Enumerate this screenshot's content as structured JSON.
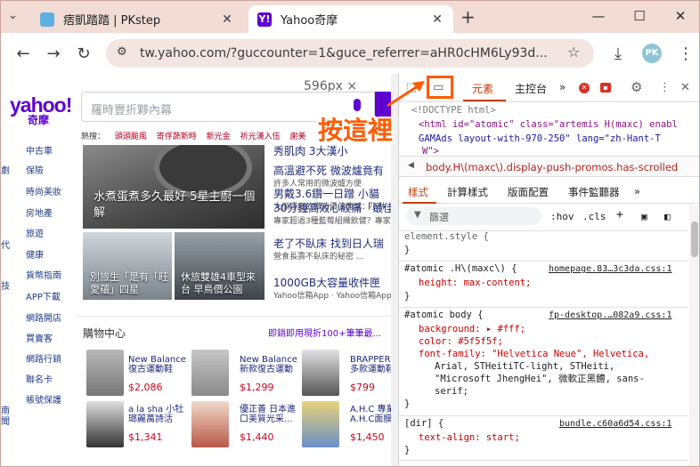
{
  "tabs": [
    {
      "title": "痞凱踏踏 | PKstep",
      "favicon_color": "#5bb0e0"
    },
    {
      "title": "Yahoo奇摩",
      "favicon_color": "#5f01d1"
    }
  ],
  "window": {
    "new_tab": "+",
    "minimize": "—",
    "maximize": "☐",
    "close": "✕"
  },
  "toolbar": {
    "back": "←",
    "forward": "→",
    "reload": "↻",
    "url": "tw.yahoo.com/?guccounter=1&guce_referrer=aHR0cHM6Ly93d...",
    "star": "☆",
    "download": "⤓",
    "avatar": "PK",
    "menu": "⋮"
  },
  "viewport": {
    "dims": "596px × 588px",
    "logo": "yahoo!",
    "logo_sub": "奇摩",
    "search_placeholder": "羅時豐折夥內幕",
    "hot_label": "熱搜：",
    "hot_items": [
      "頭頭颱風",
      "寄俘蔬新時",
      "新光金",
      "祈光漢入伍",
      "謝美"
    ]
  },
  "categories": [
    {
      "edge": "",
      "label": "中古車"
    },
    {
      "edge": "劇",
      "label": "保險"
    },
    {
      "edge": "",
      "label": "時尚美妝"
    },
    {
      "edge": "",
      "label": "房地產"
    },
    {
      "edge": "",
      "label": "旅遊"
    },
    {
      "edge": "代",
      "label": "健康"
    },
    {
      "edge": "",
      "label": "貨幣指南"
    },
    {
      "edge": "技",
      "label": "APP下載"
    },
    {
      "edge": "",
      "label": "網路開店"
    },
    {
      "edge": "",
      "label": "買賣客"
    },
    {
      "edge": "",
      "label": "網路行銷"
    },
    {
      "edge": "",
      "label": "聯名卡"
    },
    {
      "edge": "南",
      "label": "帳號保護"
    },
    {
      "edge": "聞",
      "label": ""
    }
  ],
  "news": {
    "main_caption": "水煮蛋煮多久最好 5星主廚一個解",
    "thumb1_caption": "別旅生「是有「旺愛蘊」四星",
    "thumb2_caption": "休旅雙雄4車型來台 早鳥價公園",
    "headlines": [
      {
        "title": "秀肌肉 3大漢小",
        "sub": "",
        "red": false
      },
      {
        "title": "高溫避不死 微波爐竟有",
        "sub": "許多人常用的微波爐方便",
        "red": false
      },
      {
        "title": "男戴3.6鑽一日蹭 小貓",
        "sub": "大傑理度的鑽石價值連城：小林",
        "red": false
      },
      {
        "title": "30分鐘高效心絞痛「最佳",
        "sub": "專家超過3種藍莓組織飲健？專家",
        "red": false
      },
      {
        "title": "老了不臥床 找到日人瑞",
        "sub": "營食長壽不臥床的秘密 ...",
        "red": false
      },
      {
        "title": "1000GB大容量收件匣",
        "sub": "Yahoo信箱App · Yahoo信箱App",
        "red": false
      }
    ]
  },
  "shop": {
    "title": "購物中心",
    "promo": "即銷即用現折100+筆筆最...",
    "products": [
      {
        "name1": "New Balance",
        "name2": "復古運動鞋",
        "price": "$2,086"
      },
      {
        "name1": "New Balance",
        "name2": "新款復古運動",
        "price": "$1,299"
      },
      {
        "name1": "BRAPPER",
        "name2": "多款運動鞋",
        "price": "$799"
      },
      {
        "name1": "a la sha 小牡",
        "name2": "瑯麗萬詩活",
        "price": "$1,341"
      },
      {
        "name1": "優正善 日本進",
        "name2": "口美質光采...",
        "price": "$1,440"
      },
      {
        "name1": "A.H.C 專業",
        "name2": "A.H.C面膜...",
        "price": "$1,450"
      }
    ]
  },
  "annotation": {
    "text": "按這裡"
  },
  "devtools": {
    "tabs": [
      "元素",
      "主控台"
    ],
    "more": "»",
    "error_badge": "✕",
    "msg_badge": "▪",
    "code_lines": {
      "doctype": "<!DOCTYPE html>",
      "html_open": "<html id=\"atomic\" class=\"artemis H(maxc) enabl",
      "html_line2": "GAMAds layout-with-970-250\" lang=\"zh-Hant-T",
      "html_line3": "W\">"
    },
    "breadcrumb": "body.H\\(maxc\\).display-push-promos.has-scrolled",
    "sub_tabs": [
      "樣式",
      "計算樣式",
      "版面配置",
      "事件監聽器",
      "»"
    ],
    "filter_placeholder": "篩選",
    "hov": ":hov",
    "cls": ".cls",
    "rules": [
      {
        "selector": "element.style {",
        "source": "",
        "props": [],
        "close": "}"
      },
      {
        "selector": "#atomic .H\\(maxc\\) {",
        "source": "homepage.83…3c3da.css:1",
        "props": [
          "height: max-content;"
        ],
        "close": "}"
      },
      {
        "selector": "#atomic body {",
        "source": "fp-desktop.…082a9.css:1",
        "props": [
          "background: ▸ #fff;",
          "color: #5f5f5f;",
          "font-family: \"Helvetica Neue\", Helvetica,",
          "Arial, STHeitiTC-light, STHeiti,",
          "\"Microsoft JhengHei\", 微軟正黑體, sans-",
          "serif;"
        ],
        "close": "}"
      },
      {
        "selector": "[dir] {",
        "source": "bundle.c60a6d54.css:1",
        "props": [
          "text-align: start;"
        ],
        "close": "}"
      }
    ]
  },
  "colors": {
    "accent_orange": "#ff5a00",
    "yahoo_purple": "#5f01d1",
    "devtools_active": "#c2410c"
  }
}
